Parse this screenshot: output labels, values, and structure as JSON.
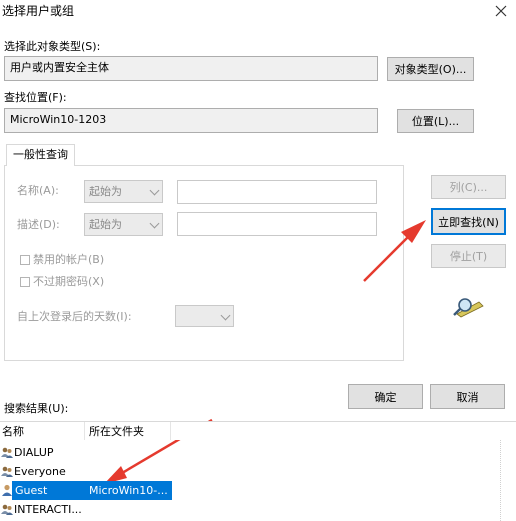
{
  "window": {
    "title": "选择用户或组",
    "close_icon": "close-icon"
  },
  "object_type": {
    "label": "选择此对象类型(S):",
    "value": "用户或内置安全主体",
    "button": "对象类型(O)..."
  },
  "location": {
    "label": "查找位置(F):",
    "value": "MicroWin10-1203",
    "button": "位置(L)..."
  },
  "query": {
    "tab": "一般性查询",
    "name_label": "名称(A):",
    "name_mode": "起始为",
    "name_value": "",
    "desc_label": "描述(D):",
    "desc_mode": "起始为",
    "desc_value": "",
    "disabled_accounts": "禁用的帐户(B)",
    "no_expire_pwd": "不过期密码(X)",
    "days_label": "自上次登录后的天数(I):",
    "days_value": ""
  },
  "buttons": {
    "columns": "列(C)...",
    "find_now": "立即查找(N)",
    "stop": "停止(T)",
    "ok": "确定",
    "cancel": "取消"
  },
  "results": {
    "label": "搜索结果(U):",
    "columns": [
      "名称",
      "所在文件夹"
    ],
    "rows": [
      {
        "name": "DIALUP",
        "folder": "",
        "selected": false
      },
      {
        "name": "Everyone",
        "folder": "",
        "selected": false
      },
      {
        "name": "Guest",
        "folder": "MicroWin10-...",
        "selected": true
      },
      {
        "name": "INTERACTI...",
        "folder": "",
        "selected": false
      }
    ]
  },
  "colors": {
    "accent": "#0078d7",
    "arrow": "#e53a2e"
  }
}
